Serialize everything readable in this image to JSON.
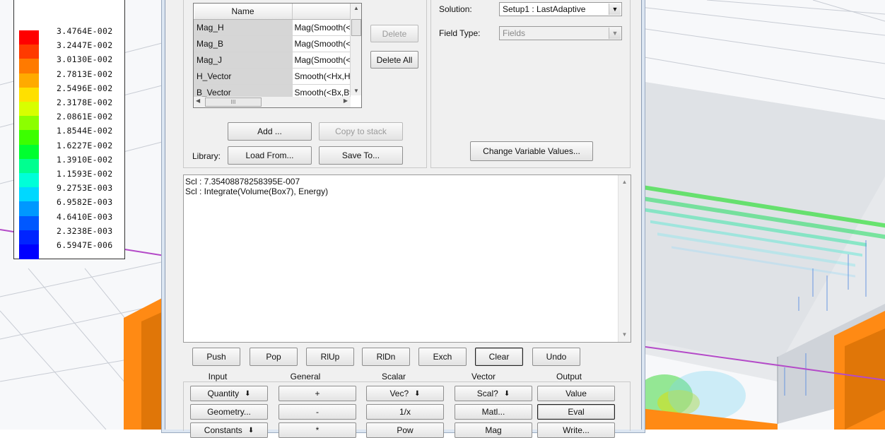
{
  "legend": {
    "values": [
      "3.4764E-002",
      "3.2447E-002",
      "3.0130E-002",
      "2.7813E-002",
      "2.5496E-002",
      "2.3178E-002",
      "2.0861E-002",
      "1.8544E-002",
      "1.6227E-002",
      "1.3910E-002",
      "1.1593E-002",
      "9.2753E-003",
      "6.9582E-003",
      "4.6410E-003",
      "2.3238E-003",
      "6.5947E-006"
    ],
    "colors": [
      "#ff0000",
      "#ff3a00",
      "#ff7a00",
      "#ffaa00",
      "#ffe000",
      "#d8ff00",
      "#8cff00",
      "#3cff00",
      "#00ff30",
      "#00ff90",
      "#00ffd8",
      "#00d8ff",
      "#0098ff",
      "#0058ff",
      "#0024ff",
      "#0000ff"
    ]
  },
  "dialog": {
    "table": {
      "header": [
        "Name",
        ""
      ],
      "rows": [
        [
          "Mag_H",
          "Mag(Smooth(<H"
        ],
        [
          "Mag_B",
          "Mag(Smooth(<E"
        ],
        [
          "Mag_J",
          "Mag(Smooth(<."
        ],
        [
          "H_Vector",
          "Smooth(<Hx,Hy"
        ],
        [
          "B_Vector",
          "Smooth(<Bx,By"
        ]
      ],
      "hscroll_thumb": "III"
    },
    "buttons": {
      "delete": "Delete",
      "delete_all": "Delete All",
      "add": "Add ...",
      "copy_to_stack": "Copy to stack",
      "load_from": "Load From...",
      "save_to": "Save To...",
      "change_variable_values": "Change Variable Values..."
    },
    "library_label": "Library:",
    "solution_label": "Solution:",
    "solution_value": "Setup1 : LastAdaptive",
    "field_type_label": "Field Type:",
    "field_type_value": "Fields",
    "stack_lines": [
      "Scl : 7.35408878258395E-007",
      "Scl : Integrate(Volume(Box7), Energy)"
    ],
    "stack_buttons": [
      "Push",
      "Pop",
      "RlUp",
      "RlDn",
      "Exch",
      "Clear",
      "Undo"
    ],
    "section_headers": [
      "Input",
      "General",
      "Scalar",
      "Vector",
      "Output"
    ],
    "calc_row1": [
      "Quantity",
      "+",
      "Vec?",
      "Scal?",
      "Value"
    ],
    "calc_row2": [
      "Geometry...",
      "-",
      "1/x",
      "Matl...",
      "Eval"
    ],
    "calc_row3": [
      "Constants",
      "*",
      "Pow",
      "Mag",
      "Write..."
    ]
  },
  "colors": {
    "orange": "#ff8a14",
    "magenta_line": "#b44ac8",
    "box_gray": "#dadde2"
  }
}
